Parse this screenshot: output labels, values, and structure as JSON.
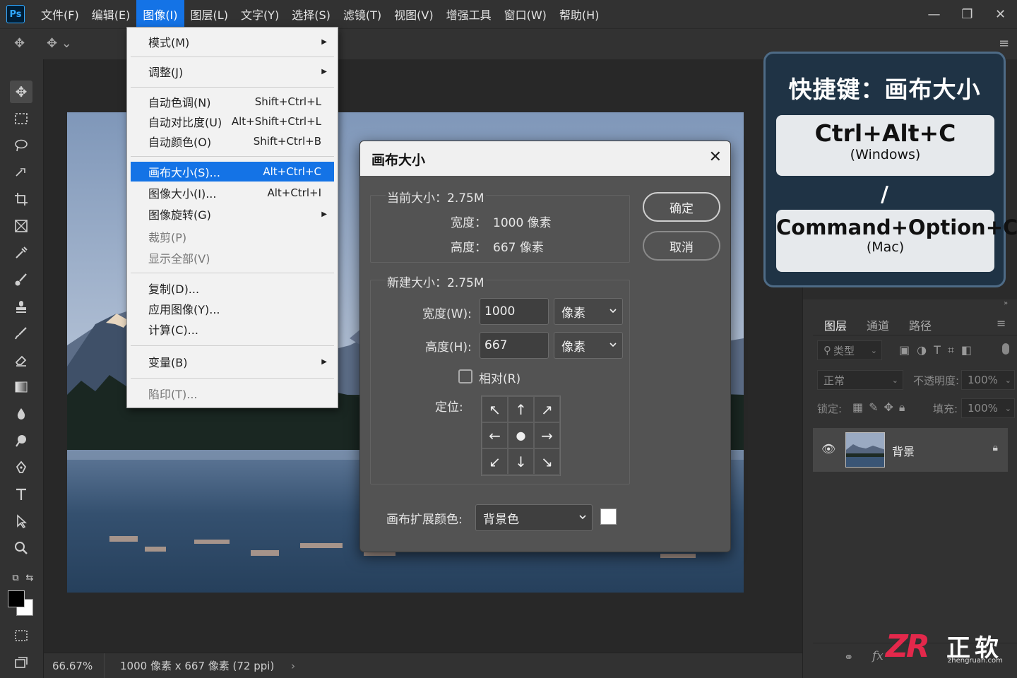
{
  "app": {
    "logo": "Ps",
    "menus": [
      "文件(F)",
      "编辑(E)",
      "图像(I)",
      "图层(L)",
      "文字(Y)",
      "选择(S)",
      "滤镜(T)",
      "视图(V)",
      "增强工具",
      "窗口(W)",
      "帮助(H)"
    ],
    "active_menu": "图像(I)"
  },
  "image_menu": {
    "items": [
      {
        "label": "模式(M)",
        "submenu": true
      },
      {
        "label": "调整(J)",
        "submenu": true
      },
      {
        "label": "自动色调(N)",
        "shortcut": "Shift+Ctrl+L"
      },
      {
        "label": "自动对比度(U)",
        "shortcut": "Alt+Shift+Ctrl+L"
      },
      {
        "label": "自动颜色(O)",
        "shortcut": "Shift+Ctrl+B"
      },
      {
        "label": "画布大小(S)...",
        "shortcut": "Alt+Ctrl+C",
        "highlighted": true
      },
      {
        "label": "图像大小(I)...",
        "shortcut": "Alt+Ctrl+I"
      },
      {
        "label": "图像旋转(G)",
        "submenu": true
      },
      {
        "label": "裁剪(P)",
        "disabled": true
      },
      {
        "label": "显示全部(V)",
        "disabled": true
      },
      {
        "label": "复制(D)..."
      },
      {
        "label": "应用图像(Y)..."
      },
      {
        "label": "计算(C)..."
      },
      {
        "label": "变量(B)",
        "submenu": true
      },
      {
        "label": "陷印(T)...",
        "disabled": true
      }
    ]
  },
  "dialog": {
    "title": "画布大小",
    "current_size_label": "当前大小：2.75M",
    "current_width_label": "宽度：",
    "current_width_value": "1000 像素",
    "current_height_label": "高度：",
    "current_height_value": "667 像素",
    "new_size_label": "新建大小：2.75M",
    "width_label": "宽度(W):",
    "width_value": "1000",
    "width_unit": "像素",
    "height_label": "高度(H):",
    "height_value": "667",
    "height_unit": "像素",
    "relative_label": "相对(R)",
    "anchor_label": "定位:",
    "extension_color_label": "画布扩展颜色:",
    "extension_color_value": "背景色",
    "extension_swatch_color": "#ffffff",
    "ok_label": "确定",
    "cancel_label": "取消"
  },
  "shortcut_card": {
    "title": "快捷键：画布大小",
    "windows_keys": "Ctrl+Alt+C",
    "windows_os": "(Windows)",
    "separator": "/",
    "mac_keys": "Command+Option+C",
    "mac_os": "(Mac)"
  },
  "layers_panel": {
    "tabs": [
      "图层",
      "通道",
      "路径"
    ],
    "filter_label": "类型",
    "blend_mode": "正常",
    "opacity_label": "不透明度:",
    "opacity_value": "100%",
    "lock_label": "锁定:",
    "fill_label": "填充:",
    "fill_value": "100%",
    "layer_name": "背景"
  },
  "status": {
    "zoom": "66.67%",
    "doc_info": "1000 像素 x 667 像素 (72 ppi)"
  },
  "watermark": {
    "mark": "ZR",
    "name": "正软",
    "url": "zhengruan.com"
  },
  "colors": {
    "accent": "#1473e6",
    "card_bg": "#1f3345",
    "watermark_red": "#e3284b"
  }
}
